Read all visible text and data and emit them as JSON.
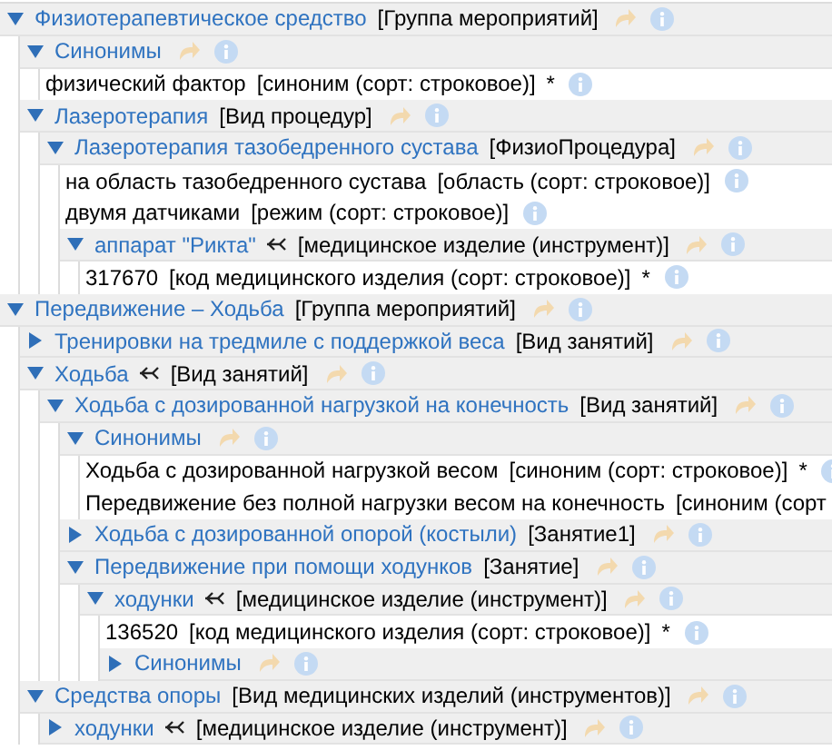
{
  "tree": [
    {
      "kind": "group",
      "name": "Физиотерапевтическое средство",
      "type": "[Группа мероприятий]",
      "expanded": true,
      "linked": false,
      "children": [
        {
          "kind": "group",
          "name": "Синонимы",
          "expanded": true,
          "linked": false,
          "children": [
            {
              "kind": "value",
              "name": "физический фактор",
              "type": "[синоним (сорт: строковое)]",
              "star": "*",
              "info": true
            }
          ]
        },
        {
          "kind": "group",
          "name": "Лазеротерапия",
          "type": "[Вид процедур]",
          "expanded": true,
          "linked": false,
          "children": [
            {
              "kind": "group",
              "name": "Лазеротерапия тазобедренного сустава",
              "type": "[ФизиоПроцедура]",
              "expanded": true,
              "linked": false,
              "children": [
                {
                  "kind": "value",
                  "name": "на область тазобедренного сустава",
                  "type": "[область (сорт: строковое)]",
                  "info": true
                },
                {
                  "kind": "value",
                  "name": "двумя датчиками",
                  "type": "[режим (сорт: строковое)]",
                  "info": true
                },
                {
                  "kind": "group",
                  "name": "аппарат \"Рикта\"",
                  "type": "[медицинское изделие (инструмент)]",
                  "expanded": true,
                  "linked": true,
                  "children": [
                    {
                      "kind": "value",
                      "name": "317670",
                      "type": "[код медицинского изделия (сорт: строковое)]",
                      "star": "*",
                      "info": true
                    }
                  ]
                }
              ]
            }
          ]
        }
      ]
    },
    {
      "kind": "group",
      "name": "Передвижение – Ходьба",
      "type": "[Группа мероприятий]",
      "expanded": true,
      "linked": false,
      "children": [
        {
          "kind": "group",
          "name": "Тренировки на тредмиле с поддержкой веса",
          "type": "[Вид занятий]",
          "expanded": false,
          "linked": false
        },
        {
          "kind": "group",
          "name": "Ходьба",
          "type": "[Вид занятий]",
          "expanded": true,
          "linked": true,
          "children": [
            {
              "kind": "group",
              "name": "Ходьба с дозированной нагрузкой на конечность",
              "type": "[Вид занятий]",
              "expanded": true,
              "linked": false,
              "children": [
                {
                  "kind": "group",
                  "name": "Синонимы",
                  "expanded": true,
                  "linked": false,
                  "children": [
                    {
                      "kind": "value",
                      "name": "Ходьба с дозированной нагрузкой весом",
                      "type": "[синоним (сорт: строковое)]",
                      "star": "*",
                      "info": true
                    },
                    {
                      "kind": "value",
                      "name": "Передвижение без полной нагрузки весом на конечность",
                      "type": "[синоним (сорт",
                      "info": false
                    }
                  ]
                },
                {
                  "kind": "group",
                  "name": "Ходьба с дозированной опорой (костыли)",
                  "type": "[Занятие1]",
                  "expanded": false,
                  "linked": false
                },
                {
                  "kind": "group",
                  "name": "Передвижение при помощи ходунков",
                  "type": "[Занятие]",
                  "expanded": true,
                  "linked": false,
                  "children": [
                    {
                      "kind": "group",
                      "name": "ходунки",
                      "type": "[медицинское изделие (инструмент)]",
                      "expanded": true,
                      "linked": true,
                      "children": [
                        {
                          "kind": "value",
                          "name": "136520",
                          "type": "[код медицинского изделия (сорт: строковое)]",
                          "star": "*",
                          "info": true
                        },
                        {
                          "kind": "group",
                          "name": "Синонимы",
                          "expanded": false,
                          "linked": false
                        }
                      ]
                    }
                  ]
                }
              ]
            }
          ]
        },
        {
          "kind": "group",
          "name": "Средства опоры",
          "type": "[Вид медицинских изделий (инструментов)]",
          "expanded": true,
          "linked": false,
          "children": [
            {
              "kind": "group",
              "name": "ходунки",
              "type": "[медицинское изделие (инструмент)]",
              "expanded": false,
              "linked": true
            }
          ]
        }
      ]
    }
  ]
}
